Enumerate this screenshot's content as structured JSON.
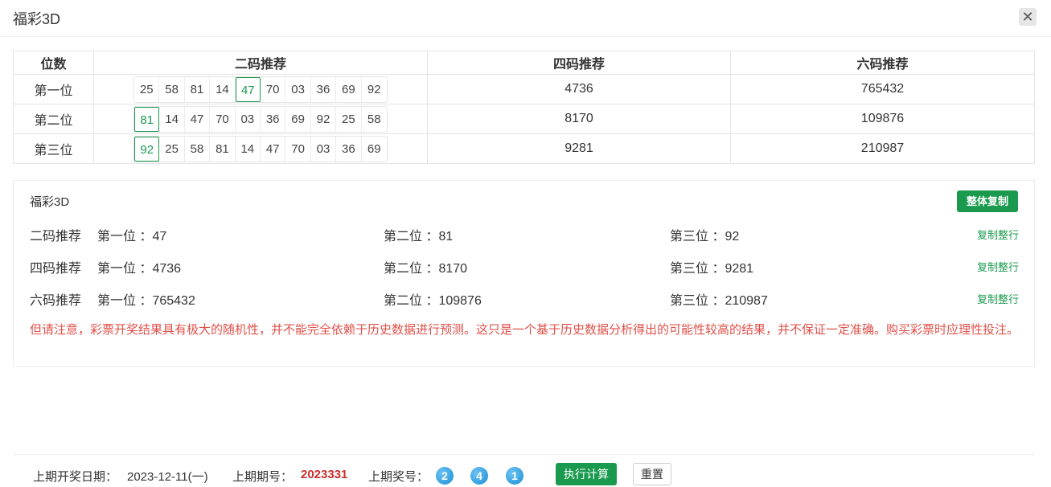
{
  "dialog": {
    "title": "福彩3D",
    "close_glyph": "✕"
  },
  "table": {
    "headers": [
      "位数",
      "二码推荐",
      "四码推荐",
      "六码推荐"
    ],
    "rows": [
      {
        "pos": "第一位",
        "nums": [
          "25",
          "58",
          "81",
          "14",
          "47",
          "70",
          "03",
          "36",
          "69",
          "92"
        ],
        "highlight": 4,
        "four": "4736",
        "six": "765432"
      },
      {
        "pos": "第二位",
        "nums": [
          "81",
          "14",
          "47",
          "70",
          "03",
          "36",
          "69",
          "92",
          "25",
          "58"
        ],
        "highlight": 0,
        "four": "8170",
        "six": "109876"
      },
      {
        "pos": "第三位",
        "nums": [
          "92",
          "25",
          "58",
          "81",
          "14",
          "47",
          "70",
          "03",
          "36",
          "69"
        ],
        "highlight": 0,
        "four": "9281",
        "six": "210987"
      }
    ]
  },
  "summary": {
    "title": "福彩3D",
    "copy_all_label": "整体复制",
    "copy_row_label": "复制整行",
    "rows": [
      {
        "label": "二码推荐",
        "p1": "第一位 ：47",
        "p2": "第二位 ：81",
        "p3": "第三位 ：92"
      },
      {
        "label": "四码推荐",
        "p1": "第一位 ：4736",
        "p2": "第二位 ：8170",
        "p3": "第三位 ：9281"
      },
      {
        "label": "六码推荐",
        "p1": "第一位 ：765432",
        "p2": "第二位 ：109876",
        "p3": "第三位 ：210987"
      }
    ],
    "warning": "但请注意，彩票开奖结果具有极大的随机性，并不能完全依赖于历史数据进行预测。这只是一个基于历史数据分析得出的可能性较高的结果，并不保证一定准确。购买彩票时应理性投注。"
  },
  "footer": {
    "date_label": "上期开奖日期：",
    "date_value": "2023-12-11(一)",
    "issue_label": "上期期号：",
    "issue_value": "2023331",
    "balls_label": "上期奖号：",
    "balls": [
      "2",
      "4",
      "1"
    ],
    "exec_label": "执行计算",
    "reset_label": "重置"
  },
  "colors": {
    "accent": "#1a9a4e",
    "warning": "#e0504a",
    "issue": "#c9302c",
    "ball": "#1b8fd6"
  }
}
